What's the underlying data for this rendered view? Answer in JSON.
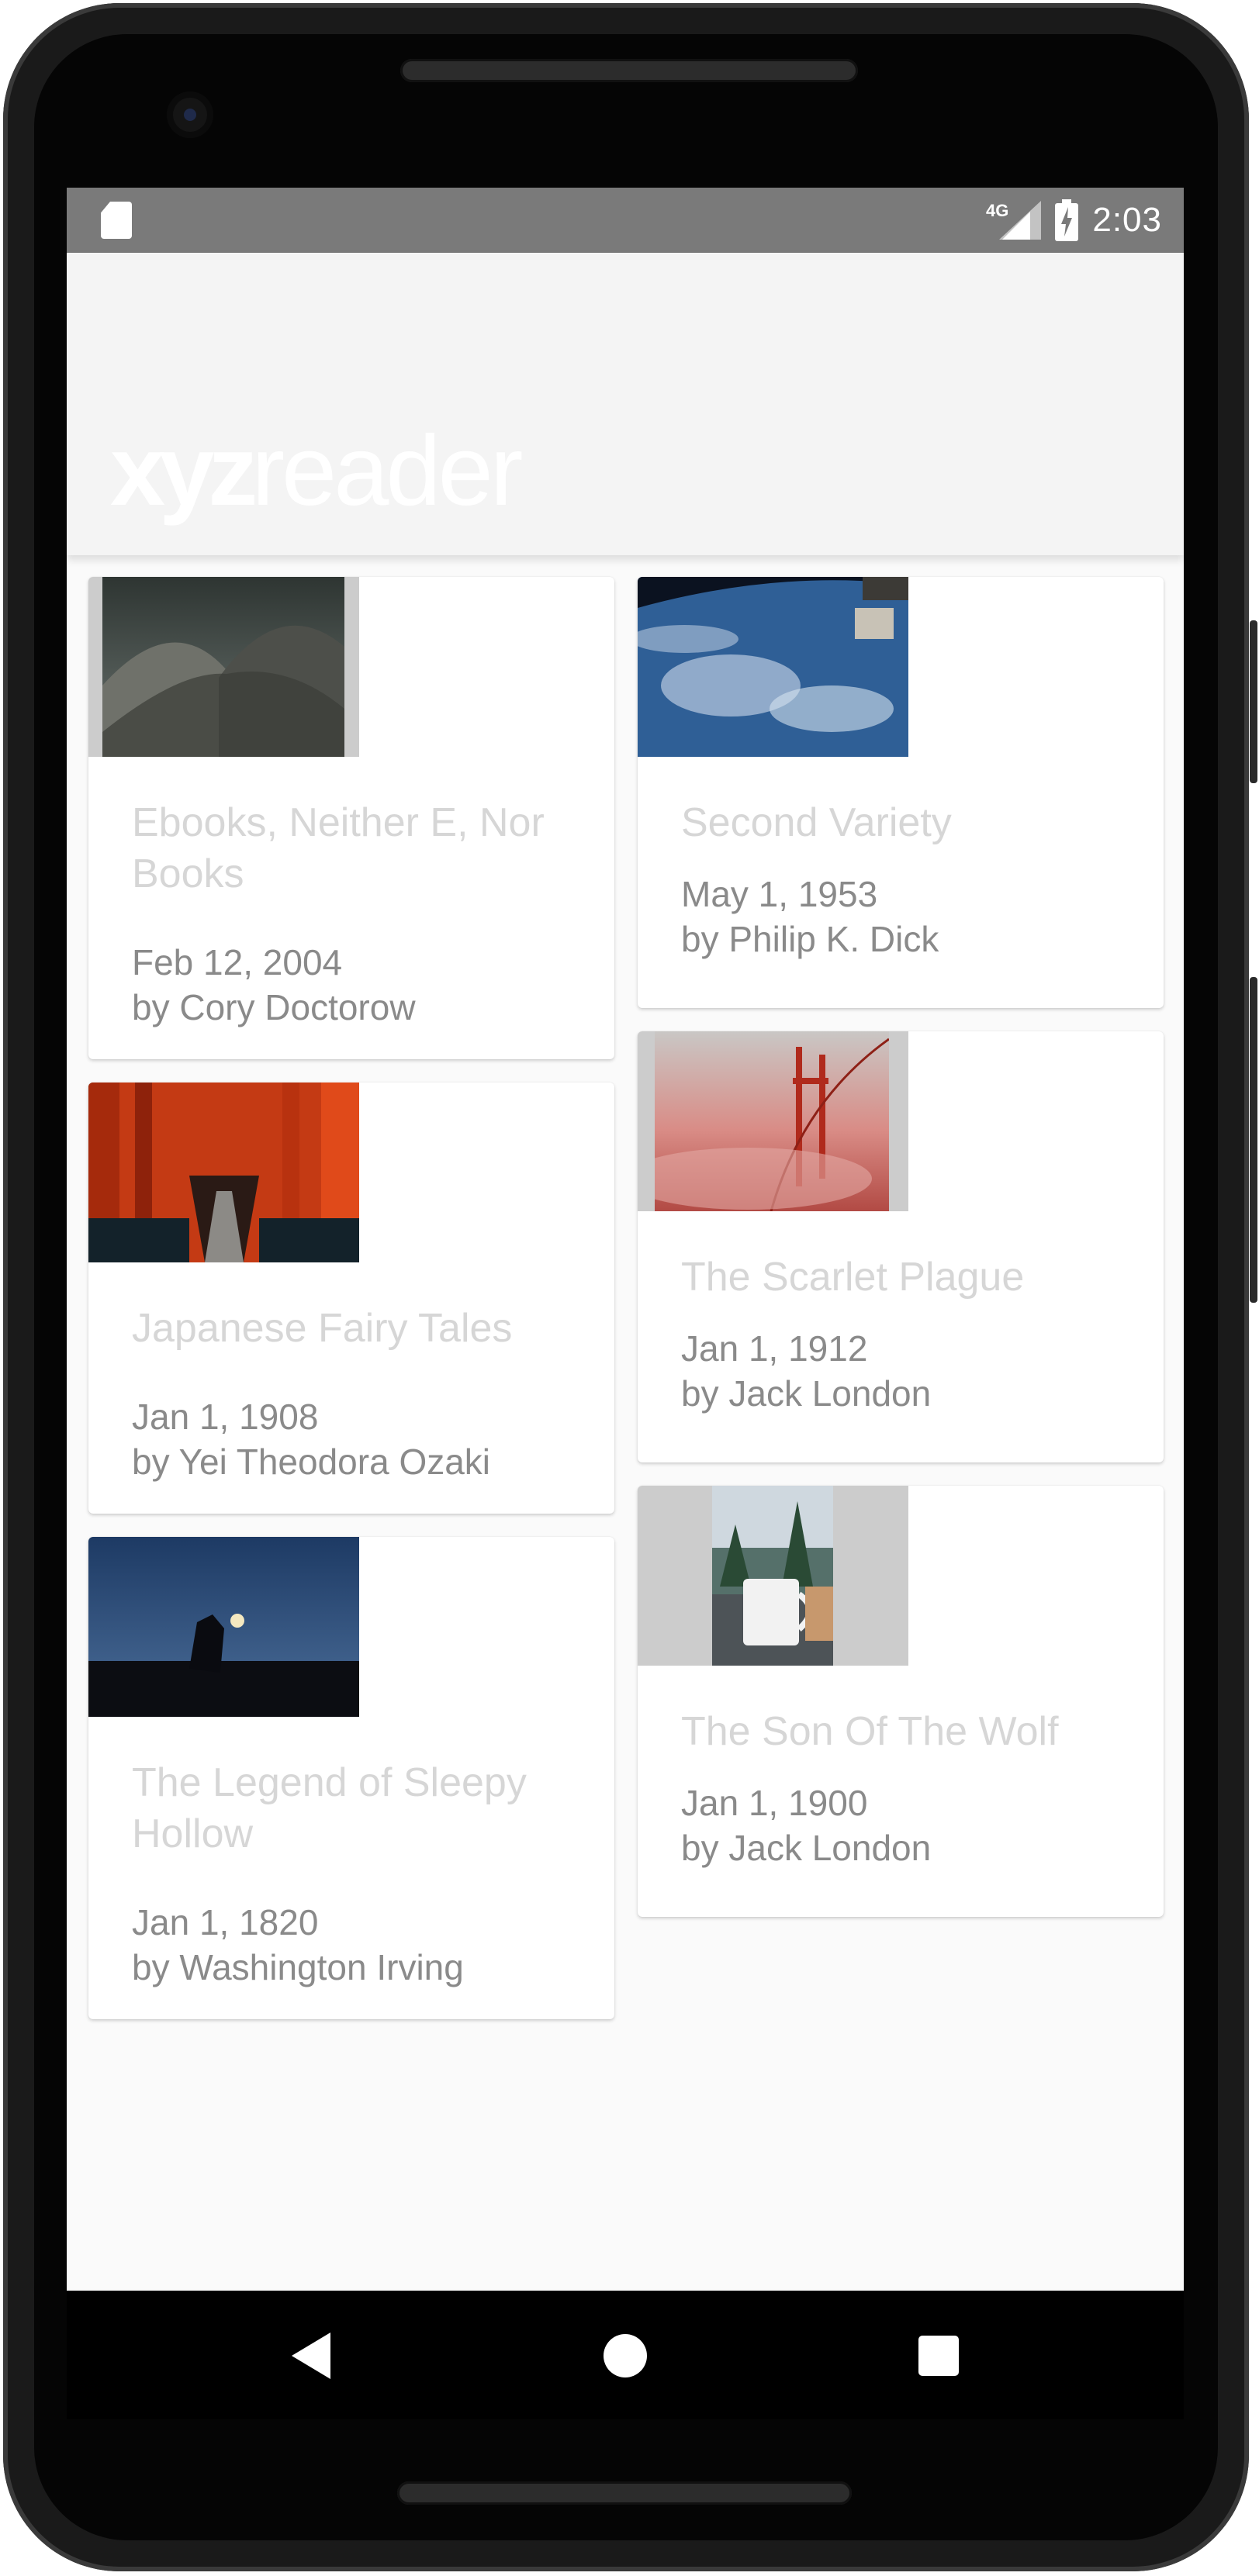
{
  "status_bar": {
    "network_type": "4G",
    "time": "2:03",
    "icons": [
      "sd-card-icon",
      "signal-icon",
      "battery-charging-icon"
    ]
  },
  "app_bar": {
    "logo_bold": "xyz",
    "logo_light": "reader"
  },
  "articles": [
    {
      "title": "Ebooks, Neither E, Nor Books",
      "date": "Feb 12, 2004",
      "author": "by Cory Doctorow",
      "image": "dome-roof-photo"
    },
    {
      "title": "Japanese Fairy Tales",
      "date": "Jan 1, 1908",
      "author": "by Yei Theodora Ozaki",
      "image": "torii-gates-photo"
    },
    {
      "title": "The Legend of Sleepy Hollow",
      "date": "Jan 1, 1820",
      "author": "by Washington Irving",
      "image": "lantern-silhouette-photo"
    },
    {
      "title": "Second Variety",
      "date": "May 1, 1953",
      "author": "by Philip K. Dick",
      "image": "earth-from-space-photo"
    },
    {
      "title": "The Scarlet Plague",
      "date": "Jan 1, 1912",
      "author": "by Jack London",
      "image": "golden-gate-fog-photo"
    },
    {
      "title": "The Son Of The Wolf",
      "date": "Jan 1, 1900",
      "author": "by Jack London",
      "image": "camping-mug-photo"
    }
  ],
  "nav_bar": {
    "icons": [
      "back-icon",
      "home-icon",
      "recents-icon"
    ]
  },
  "colors": {
    "status_bar": "#7a7a7a",
    "toolbar": "#f4f4f4",
    "screen_bg": "#fafafa",
    "title_text": "#d6d6d6",
    "meta_text": "#8a8a8a"
  }
}
